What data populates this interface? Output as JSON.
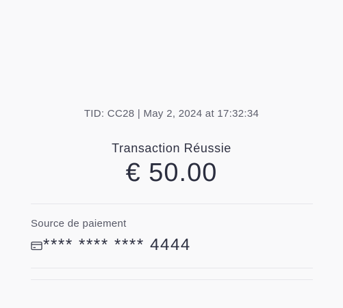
{
  "transaction": {
    "tid_line": "TID: CC28 | May 2, 2024 at 17:32:34",
    "status": "Transaction Réussie",
    "amount": "€ 50.00"
  },
  "payment": {
    "label": "Source de paiement",
    "card_icon": "credit-card-icon",
    "card_number": "**** **** **** 4444"
  }
}
